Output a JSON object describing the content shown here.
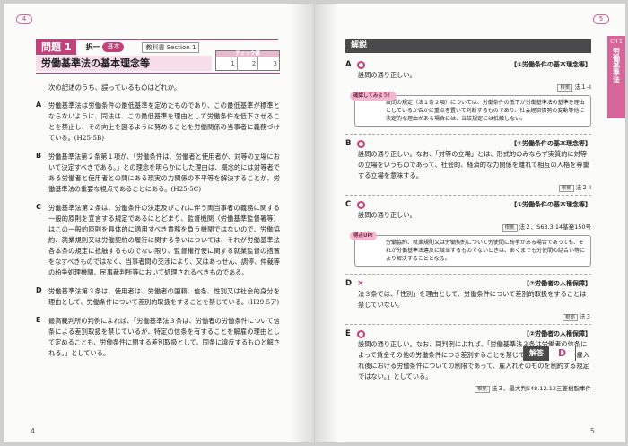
{
  "left": {
    "tab_number": "4",
    "page_number": "4",
    "question_label": "問題 1",
    "selection": "択一",
    "level_badge": "基本",
    "textbook_ref": "教科書 Section 1",
    "check_header": "チェック欄",
    "check_cells": [
      "1",
      "2",
      "3"
    ],
    "title": "労働基準法の基本理念等",
    "intro": "次の記述のうち、誤っているものはどれか。",
    "items": [
      {
        "letter": "A",
        "text": "労働基準法は労働条件の最低基準を定めたものであり、この最低基準が標準とならないように、同法は、この最低基準を理由として労働条件を低下させることを禁止し、その向上を図るように努めることを労働関係の当事者に義務づけている。(H25-5B)"
      },
      {
        "letter": "B",
        "text": "労働基準法第２条第１項が、「労働条件は、労働者と使用者が、対等の立場において決定すべきである。」との理念を明らかにした理由は、概念的には対等者である労働者と使用者との間にある現実の力関係の不平等を解決することが、労働基準法の重要な視点であることにある。(H25-5C)"
      },
      {
        "letter": "C",
        "text": "労働基準法第２条は、労働条件の決定及びこれに伴う両当事者の義務に関する一般的原則を宣言する規定であるにとどまり、監督機関（労働基準監督署等）はこの一般的原則を具体的に適用すべき責務を負う機関ではないので、労働協約、就業規則又は労働契約の履行に関する争いについては、それが労働基準法各本条の規定に抵触するものでない限り、監督権行使に関する就業監督の措置をなすべきものではなく、当事者間の交渉により、又はあっせん、調停、仲裁等の紛争処理機関、民事裁判所等において処理されるべきものである。"
      },
      {
        "letter": "D",
        "text": "労働基準法第３条は、使用者は、労働者の国籍、信条、性別又は社会的身分を理由として、労働条件について差別的取扱をすることを禁じている。(H29-5ア)"
      },
      {
        "letter": "E",
        "text": "最高裁判所の判例によれば、「労働基準法３条は、労働者の労働条件について信条による差別取扱を禁じているが、特定の信条を有することを解雇の理由として定めることも、労働条件に関する差別取扱として、同条に違反するものと解される。」としている。"
      }
    ]
  },
  "right": {
    "tab_number": "5",
    "page_number": "5",
    "side_tab_chapter": "CH 1",
    "side_tab_title": "労働基準法",
    "header": "解説",
    "answers": [
      {
        "letter": "A",
        "mark": "○",
        "topic": "【①労働条件の基本理念等】",
        "text": "設問の通り正しい。",
        "ref_tag": "根拠",
        "ref": "法１-Ⅱ"
      },
      {
        "letter": "B",
        "mark": "○",
        "topic": "【①労働条件の基本理念等】",
        "text": "設問の通り正しい。なお、「対等の立場」とは、形式的のみならず実質的に対等の立場をいうものであって、社会的、経済的な力関係を離れて相互の人格を尊重する立場を意味する。",
        "ref_tag": "根拠",
        "ref": "法２-Ⅰ"
      },
      {
        "letter": "C",
        "mark": "○",
        "topic": "【①労働条件の基本理念等】",
        "text": "設問の通り正しい。",
        "ref_tag": "根拠",
        "ref": "法２、S63.3.14基発150号"
      },
      {
        "letter": "D",
        "mark": "×",
        "topic": "【②労働者の人権保障】",
        "text": "法３条では、「性別」を理由として、労働条件について差別的取扱をすることは禁じていない。",
        "ref_tag": "根拠",
        "ref": "法３"
      },
      {
        "letter": "E",
        "mark": "○",
        "topic": "【②労働者の人権保障】",
        "text": "設問の通り正しい。なお、同判例によれば、「労働基準法３条は労働者の信条によって賃金その他の労働条件につき差別することを禁じているが、これは、雇入れ後における労働条件についての制限であって、雇入れそのものを制約する規定ではない。」としている。",
        "ref_tag": "根拠",
        "ref": "法３、最大判S48.12.12三菱樹脂事件"
      }
    ],
    "note1_badge": "確認してみよう！",
    "note1_text": "設問の規定（法１条２項）については、労働条件の低下が労働基準法の基準を理由としているか否かに重点を置いて判断するものであり、社会経済情勢の変動等他に決定的な理由がある場合には、当該規定には抵触しない。",
    "note2_badge": "得点UP!",
    "note2_text": "労働協約、就業規則又は労働契約について労使間に紛争がある場合であっても、それが労働基準法違反に該当するものでないときは、あくまでも労使間の話合い等により解決することとなる。",
    "final_label": "解答",
    "final_answer": "D"
  },
  "colors": {
    "accent": "#c2417a",
    "accent_light": "#f7dde8",
    "dark": "#4a4a4a"
  }
}
